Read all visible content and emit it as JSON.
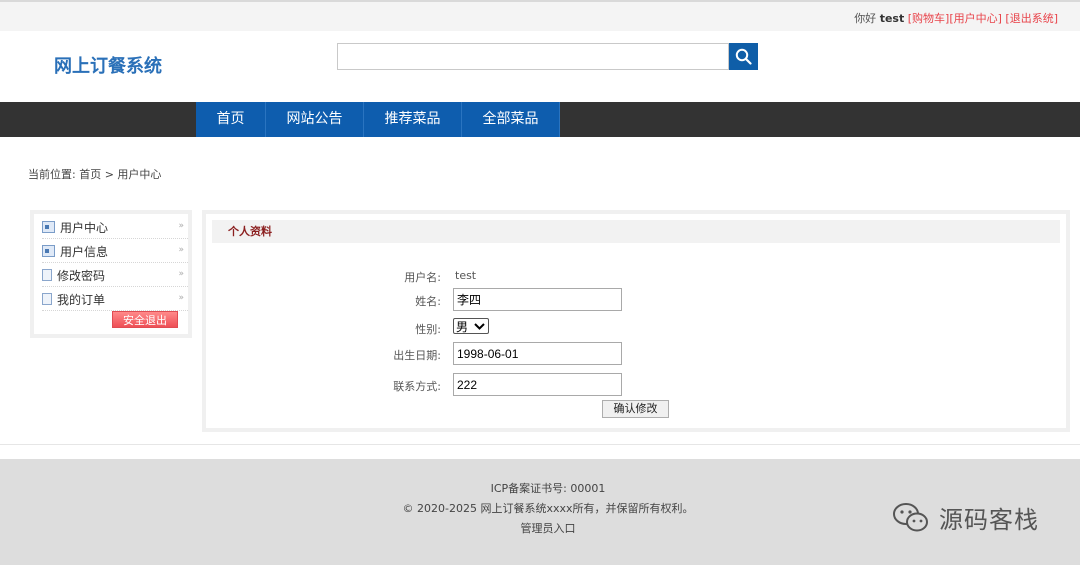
{
  "topbar": {
    "greeting": "你好",
    "username": "test",
    "links": [
      "[购物车]",
      "[用户中心]",
      "[退出系统]"
    ]
  },
  "header": {
    "logo": "网上订餐系统",
    "search": {
      "value": "",
      "placeholder": ""
    }
  },
  "nav": {
    "items": [
      "首页",
      "网站公告",
      "推荐菜品",
      "全部菜品"
    ]
  },
  "breadcrumb": "当前位置: 首页 > 用户中心",
  "sidebar": {
    "items": [
      {
        "label": "用户中心",
        "icon": "user-card-icon"
      },
      {
        "label": "用户信息",
        "icon": "user-card-icon"
      },
      {
        "label": "修改密码",
        "icon": "document-icon"
      },
      {
        "label": "我的订单",
        "icon": "document-icon"
      }
    ],
    "logout": "安全退出"
  },
  "profile": {
    "title": "个人资料",
    "username_label": "用户名:",
    "username": "test",
    "name_label": "姓名:",
    "name": "李四",
    "gender_label": "性别:",
    "gender": "男",
    "birth_label": "出生日期:",
    "birth": "1998-06-01",
    "contact_label": "联系方式:",
    "contact": "222",
    "confirm": "确认修改"
  },
  "footer": {
    "icp": "ICP备案证书号: 00001",
    "copyright": "© 2020-2025 网上订餐系统xxxx所有，并保留所有权利。",
    "admin": "管理员入口",
    "watermark": "源码客栈"
  },
  "colors": {
    "brand_blue": "#0e5dae",
    "nav_bar": "#333333",
    "link_red": "#e8434a",
    "panel_title": "#8b1f1f"
  }
}
